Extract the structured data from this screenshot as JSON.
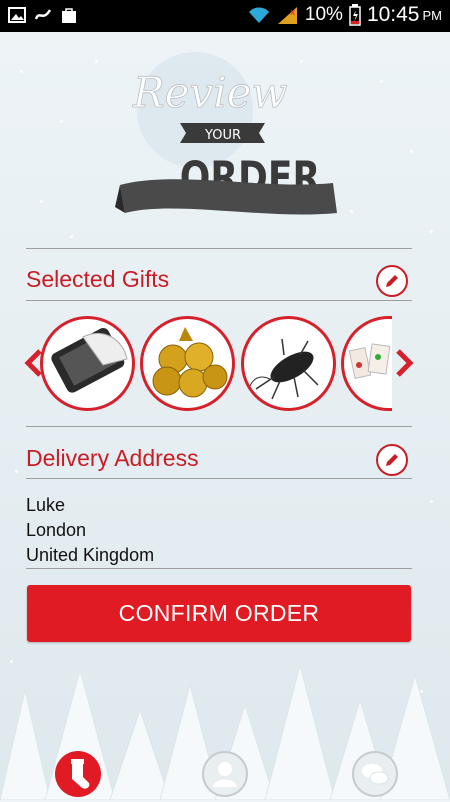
{
  "status_bar": {
    "battery": "10%",
    "time": "10:45",
    "ampm": "PM"
  },
  "header": {
    "line1": "Review",
    "line2": "YOUR",
    "line3": "ORDER"
  },
  "gifts": {
    "title": "Selected Gifts",
    "items": [
      "phone-icon",
      "gold-coins-icon",
      "cockroach-icon",
      "notebook-icon"
    ]
  },
  "delivery": {
    "title": "Delivery Address",
    "name": "Luke",
    "city": "London",
    "country": "United Kingdom"
  },
  "confirm_label": "CONFIRM ORDER",
  "nav": {
    "items": [
      "stocking-icon",
      "profile-icon",
      "chat-icon"
    ]
  },
  "colors": {
    "accent": "#e01b23",
    "title": "#c81d25"
  }
}
